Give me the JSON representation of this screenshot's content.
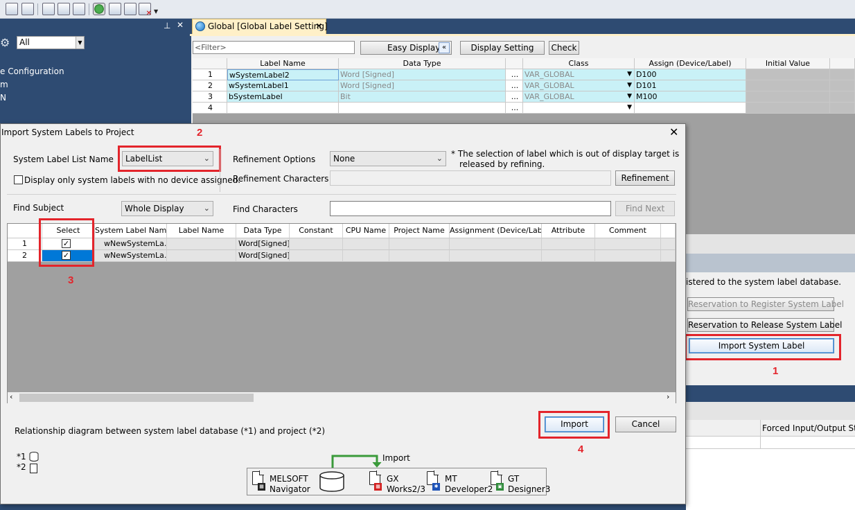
{
  "toolbar": {
    "icons": [
      "program-icon",
      "label-icon",
      "device-icon",
      "monitor-icon",
      "green-status-icon",
      "window-icon",
      "window2-icon",
      "window-close-icon"
    ]
  },
  "left_pane": {
    "filter_value": "All",
    "items": [
      "e Configuration",
      "m",
      "N"
    ]
  },
  "document": {
    "tab_title": "Global [Global Label Setting]",
    "filter_placeholder": "<Filter>",
    "easy_display_label": "Easy Display",
    "display_setting_label": "Display Setting",
    "check_label": "Check",
    "columns": [
      "Label Name",
      "Data Type",
      "Class",
      "Assign (Device/Label)",
      "Initial Value"
    ],
    "rows": [
      {
        "num": "1",
        "label": "wSystemLabel2",
        "type": "Word [Signed]",
        "class": "VAR_GLOBAL",
        "assign": "D100"
      },
      {
        "num": "2",
        "label": "wSystemLabel1",
        "type": "Word [Signed]",
        "class": "VAR_GLOBAL",
        "assign": "D101"
      },
      {
        "num": "3",
        "label": "bSystemLabel",
        "type": "Bit",
        "class": "VAR_GLOBAL",
        "assign": "M100"
      },
      {
        "num": "4",
        "label": "",
        "type": "",
        "class": "",
        "assign": ""
      }
    ],
    "ellipsis": "..."
  },
  "right_panel": {
    "registered_text": "istered to the system label database.",
    "reserve_register_label": "Reservation to Register System Label",
    "reserve_release_label": "Reservation to Release System Label",
    "import_system_label": "Import System Label",
    "forced_io_header": "Forced Input/Output St"
  },
  "dialog": {
    "title": "Import System Labels to Project",
    "close": "✕",
    "system_label_list_name_label": "System Label List Name",
    "system_label_list_name_value": "LabelList",
    "display_only_label": "Display only system labels with no device assigned.",
    "refinement_options_label": "Refinement Options",
    "refinement_options_value": "None",
    "refine_note_line1": "* The selection of label which is out of display target is",
    "refine_note_line2": "released by refining.",
    "refinement_characters_label": "Refinement Characters",
    "refinement_button": "Refinement",
    "find_subject_label": "Find Subject",
    "find_subject_value": "Whole Display",
    "find_characters_label": "Find Characters",
    "find_next_button": "Find Next",
    "table_columns": [
      "Select",
      "System Label Name",
      "Label Name",
      "Data Type",
      "Constant",
      "CPU Name",
      "Project Name",
      "Assignment (Device/Label)",
      "Attribute",
      "Comment"
    ],
    "table_rows": [
      {
        "num": "1",
        "checked": true,
        "system_label_name": "wNewSystemLa...",
        "data_type": "Word[Signed]"
      },
      {
        "num": "2",
        "checked": true,
        "system_label_name": "wNewSystemLa...",
        "data_type": "Word[Signed]"
      }
    ],
    "relationship_text": "Relationship diagram between system label database (*1) and project (*2)",
    "legend1": "*1",
    "legend2": "*2",
    "import_button": "Import",
    "cancel_button": "Cancel",
    "diagram": {
      "import_label": "Import",
      "melsoft_line1": "MELSOFT",
      "melsoft_line2": "Navigator",
      "gx_line1": "GX",
      "gx_line2": "Works2/3",
      "mt_line1": "MT",
      "mt_line2": "Developer2",
      "gt_line1": "GT",
      "gt_line2": "Designer3"
    }
  },
  "annotations": {
    "step1": "1",
    "step2": "2",
    "step3": "3",
    "step4": "4",
    "color": "#e3242b"
  }
}
